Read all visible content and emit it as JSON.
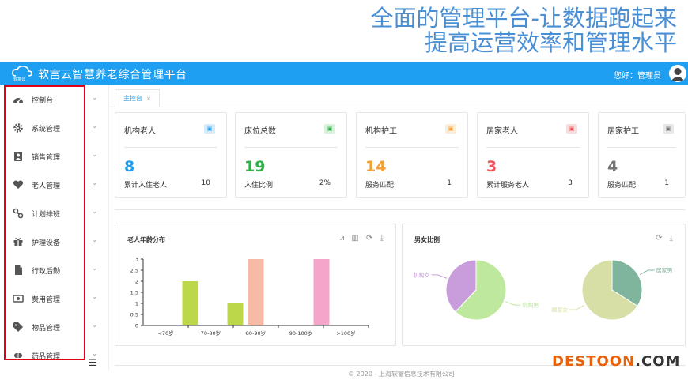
{
  "tagline": {
    "line1": "全面的管理平台-让数据跑起来",
    "line2": "提高运营效率和管理水平"
  },
  "header": {
    "logo_text": "软富云",
    "app_title": "软富云智慧养老综合管理平台",
    "user_greeting": "您好：管理员"
  },
  "sidebar": {
    "items": [
      {
        "label": "控制台",
        "icon": "dashboard-icon"
      },
      {
        "label": "系统管理",
        "icon": "gear-icon"
      },
      {
        "label": "销售管理",
        "icon": "contact-card-icon"
      },
      {
        "label": "老人管理",
        "icon": "heart-icon"
      },
      {
        "label": "计划排班",
        "icon": "link-icon"
      },
      {
        "label": "护理设备",
        "icon": "gift-icon"
      },
      {
        "label": "行政后勤",
        "icon": "document-icon"
      },
      {
        "label": "费用管理",
        "icon": "money-icon"
      },
      {
        "label": "物品管理",
        "icon": "tag-icon"
      },
      {
        "label": "药品管理",
        "icon": "pill-icon"
      }
    ],
    "chevron": "⌄",
    "toggle": "☰"
  },
  "tabs": [
    {
      "label": "主控台",
      "close": "×"
    }
  ],
  "cards": [
    {
      "title": "机构老人",
      "number": "8",
      "sub_label": "累计入住老人",
      "sub_value": "10",
      "color": "#1e9ff2",
      "badge_bg": "#d6ecfc",
      "icon": "person-badge-icon"
    },
    {
      "title": "床位总数",
      "number": "19",
      "sub_label": "入住比例",
      "sub_value": "2%",
      "color": "#2fb14a",
      "badge_bg": "#d8f3dc",
      "icon": "bed-icon"
    },
    {
      "title": "机构护工",
      "number": "14",
      "sub_label": "服务匹配",
      "sub_value": "1",
      "color": "#f5a032",
      "badge_bg": "#fdeed9",
      "icon": "nurse-icon"
    },
    {
      "title": "居家老人",
      "number": "3",
      "sub_label": "累计服务老人",
      "sub_value": "3",
      "color": "#f0535b",
      "badge_bg": "#fbdcdc",
      "icon": "home-person-icon"
    },
    {
      "title": "居家护工",
      "number": "4",
      "sub_label": "服务匹配",
      "sub_value": "1",
      "color": "#777777",
      "badge_bg": "#e8e8e8",
      "icon": "home-worker-icon"
    }
  ],
  "age_panel": {
    "title": "老人年龄分布",
    "tools": "⩘ ▥ ⟳ ⤓"
  },
  "gender_panel": {
    "title": "男女比例",
    "tools": "⟳ ⤓"
  },
  "chart_data": [
    {
      "type": "bar",
      "title": "老人年龄分布",
      "categories": [
        "<70岁",
        "70-80岁",
        "80-90岁",
        "90-100岁",
        ">100岁"
      ],
      "series": [
        {
          "values": [
            0,
            2,
            1,
            0,
            0
          ],
          "color": "#bcd84a"
        },
        {
          "values": [
            0,
            0,
            3,
            0,
            0
          ],
          "color": "#f7bba5"
        },
        {
          "values": [
            0,
            0,
            0,
            3,
            0
          ],
          "color": "#f5a6c8"
        }
      ],
      "ylim": [
        0,
        3
      ],
      "yticks": [
        "0",
        "0.5",
        "1",
        "1.5",
        "2",
        "2.5",
        "3"
      ]
    },
    {
      "type": "pie",
      "title": "男女比例",
      "pies": [
        {
          "slices": [
            {
              "label": "机构女",
              "value": 38,
              "color": "#c99ddb"
            },
            {
              "label": "机构男",
              "value": 62,
              "color": "#bde89e"
            }
          ]
        },
        {
          "slices": [
            {
              "label": "居家男",
              "value": 34,
              "color": "#7fb49d"
            },
            {
              "label": "居家女",
              "value": 66,
              "color": "#d8dfa6"
            }
          ]
        }
      ]
    }
  ],
  "footer": "© 2020 - 上海软富信息技术有限公司",
  "watermark": {
    "part1": "DESTOON",
    "part2": ".COM"
  }
}
